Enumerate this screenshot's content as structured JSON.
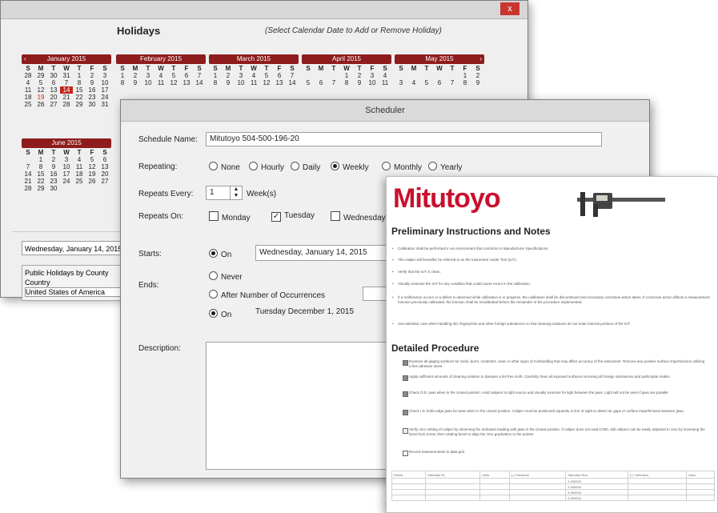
{
  "holidays": {
    "title": "Holidays",
    "hint": "(Select Calendar Date to Add or Remove Holiday)",
    "close_label": "x",
    "dow": [
      "S",
      "M",
      "T",
      "W",
      "T",
      "F",
      "S"
    ],
    "months": [
      {
        "name": "January 2015",
        "weeks": [
          [
            "28",
            "29",
            "30",
            "31",
            "1",
            "2",
            "3"
          ],
          [
            "4",
            "5",
            "6",
            "7",
            "8",
            "9",
            "10"
          ],
          [
            "11",
            "12",
            "13",
            "14",
            "15",
            "16",
            "17"
          ],
          [
            "18",
            "19",
            "20",
            "21",
            "22",
            "23",
            "24"
          ],
          [
            "25",
            "26",
            "27",
            "28",
            "29",
            "30",
            "31"
          ]
        ]
      },
      {
        "name": "February 2015",
        "weeks": [
          [
            "1",
            "2",
            "3",
            "4",
            "5",
            "6",
            "7"
          ],
          [
            "8",
            "9",
            "10",
            "11",
            "12",
            "13",
            "14"
          ]
        ]
      },
      {
        "name": "March 2015",
        "weeks": [
          [
            "1",
            "2",
            "3",
            "4",
            "5",
            "6",
            "7"
          ],
          [
            "8",
            "9",
            "10",
            "11",
            "12",
            "13",
            "14"
          ]
        ]
      },
      {
        "name": "April 2015",
        "weeks": [
          [
            "",
            "",
            "",
            "1",
            "2",
            "3",
            "4"
          ],
          [
            "5",
            "6",
            "7",
            "8",
            "9",
            "10",
            "11"
          ]
        ]
      },
      {
        "name": "May 2015",
        "weeks": [
          [
            "",
            "",
            "",
            "",
            "",
            "1",
            "2"
          ],
          [
            "3",
            "4",
            "5",
            "6",
            "7",
            "8",
            "9"
          ]
        ]
      },
      {
        "name": "June 2015",
        "weeks": [
          [
            "",
            "1",
            "2",
            "3",
            "4",
            "5",
            "6"
          ],
          [
            "7",
            "8",
            "9",
            "10",
            "11",
            "12",
            "13"
          ],
          [
            "14",
            "15",
            "16",
            "17",
            "18",
            "19",
            "20"
          ],
          [
            "21",
            "22",
            "23",
            "24",
            "25",
            "26",
            "27"
          ],
          [
            "28",
            "29",
            "30",
            "",
            "",
            "",
            ""
          ]
        ]
      }
    ],
    "selected_date": "Wednesday,  January  14, 2015",
    "public_label": "Public Holidays by County",
    "country_label": "Country",
    "country_value": "United States of America"
  },
  "scheduler": {
    "title": "Scheduler",
    "name_label": "Schedule Name:",
    "name_value": "Mitutoyo 504-500-196-20",
    "repeating_label": "Repeating:",
    "repeat_options": [
      "None",
      "Hourly",
      "Daily",
      "Weekly",
      "Monthly",
      "Yearly"
    ],
    "repeat_selected": "Weekly",
    "every_label": "Repeats Every:",
    "every_value": "1",
    "every_unit": "Week(s)",
    "on_label": "Repeats On:",
    "days": [
      "Monday",
      "Tuesday",
      "Wednesday"
    ],
    "days_checked": [
      "Tuesday"
    ],
    "starts_label": "Starts:",
    "starts_on": "On",
    "starts_date": "Wednesday,  January  14, 2015",
    "ends_label": "Ends:",
    "ends_never": "Never",
    "ends_after": "After Number of Occurrences",
    "ends_on": "On",
    "ends_date": "Tuesday   December   1, 2015",
    "desc_label": "Description:"
  },
  "doc": {
    "logo": "Mitutoyo",
    "h_prelim": "Preliminary Instructions and Notes",
    "prelim": [
      "Calibration shall be performed in an environment that conforms to Manufacturer Specifications.",
      "The caliper will hereafter be referred to as the Instrument Under Test (IUT).",
      "Verify that the IUT is clean.",
      "Visually examine the IUT for any condition that could cause errors in the calibration.",
      "If a malfunction occurs or a defect is observed while calibration is in progress, the calibration shall be discontinued and necessary corrective action taken. If corrective action affects a measurement function previously calibrated, the function shall be recalibrated before the remainder of the procedure implemented.",
      "Use antistatic care when handling dirt, fingerprints and other foreign substances so that cleaning solutions do not enter internal portions of the IUT."
    ],
    "h_detail": "Detailed Procedure",
    "steps": [
      "Examine all gaging surfaces for nicks, burrs, scratches, wear or other signs of mishandling that may affect accuracy of the instrument. Remove any positive surface imperfections utilizing a fine abrasive stone.",
      "Apply sufficient amounts of cleaning solution to dampen a lint free cloth. Carefully clean all exposed surfaces removing all foreign substances and particulate matter.",
      "Check O.D. jaws when in the closed position. Hold calipers to light source and visually examine for light between the jaws. Light will not be seen if jaws are parallel.",
      "Check I.D. knife-edge jaws for wear when in the closed position. Caliper must be positioned squarely in line of sight to detect air gaps or surface imperfections between jaws.",
      "Verify zero setting of caliper by observing the indicated reading with jaws in the closed position. If caliper does not read 0.000, dial calipers can be easily adjusted to zero by loosening the bezel lock screw, then rotating bezel to align the zero graduation to the pointer.",
      "Record measurements in data grid"
    ],
    "steps_checked": [
      true,
      true,
      true,
      true,
      false,
      false
    ],
    "table_headers": [
      "Result",
      "Standard ID",
      "Units",
      "(-) Tolerance",
      "Standard Size",
      "(+) Tolerance",
      "Data"
    ],
    "table_sizes": [
      "1.000000",
      "2.000000",
      "4.000000",
      "6.000000"
    ]
  }
}
